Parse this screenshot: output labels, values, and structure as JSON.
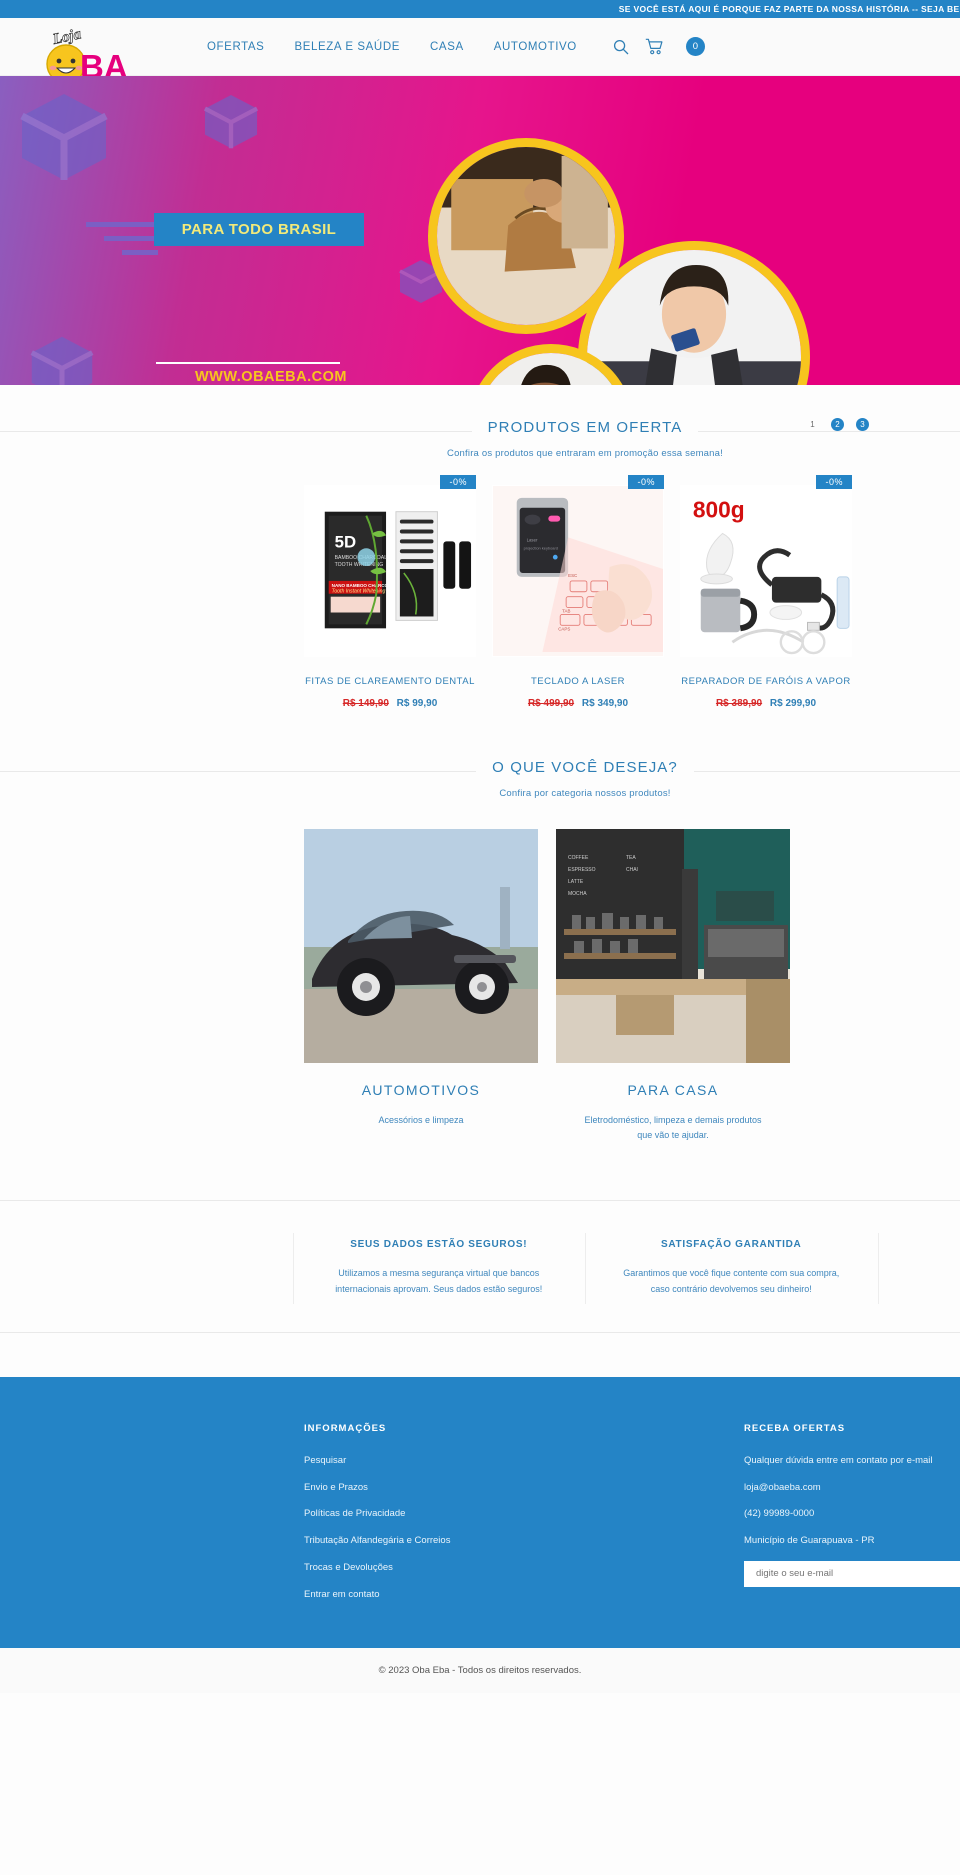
{
  "announce": {
    "text": "SE VOCÊ ESTÁ AQUI É PORQUE FAZ PARTE DA NOSSA HISTÓRIA -- SEJA BEM-VINDO!"
  },
  "header": {
    "logo_text_top": "Loja",
    "logo_text_main": "OBA",
    "nav": [
      {
        "label": "OFERTAS"
      },
      {
        "label": "BELEZA E SAÚDE"
      },
      {
        "label": "CASA"
      },
      {
        "label": "AUTOMOTIVO"
      }
    ],
    "search_icon": "search-icon",
    "cart_icon": "cart-icon",
    "cart_count": "0"
  },
  "hero": {
    "ribbon_text": "PARA TODO BRASIL",
    "url_text": "WWW.OBAEBA.COM",
    "slides": [
      {
        "label": "1"
      },
      {
        "label": "2"
      },
      {
        "label": "3"
      }
    ],
    "colors": {
      "magenta": "#e6007e",
      "purple": "#7b5fc4",
      "yellow": "#f7c51e",
      "blue": "#2484c6",
      "ribbon_text": "#f2ea7a"
    }
  },
  "offers": {
    "title": "PRODUTOS EM OFERTA",
    "subtitle": "Confira os produtos que entraram em promoção essa semana!",
    "products": [
      {
        "name": "FITAS DE CLAREAMENTO DENTAL",
        "badge": "-0%",
        "old_price": "R$ 149,90",
        "new_price": "R$ 99,90",
        "image": "teeth-whitening-strips-photo"
      },
      {
        "name": "TECLADO A LASER",
        "badge": "-0%",
        "old_price": "R$ 499,90",
        "new_price": "R$ 349,90",
        "image": "laser-keyboard-photo"
      },
      {
        "name": "REPARADOR DE FARÓIS A VAPOR",
        "badge": "-0%",
        "old_price": "R$ 389,90",
        "new_price": "R$ 299,90",
        "image": "headlight-steam-repair-kit-photo",
        "image_label": "800g"
      }
    ]
  },
  "categories": {
    "title": "O QUE VOCÊ DESEJA?",
    "subtitle": "Confira por categoria nossos produtos!",
    "items": [
      {
        "name": "AUTOMOTIVOS",
        "desc": "Acessórios e limpeza",
        "image": "classic-car-photo"
      },
      {
        "name": "PARA CASA",
        "desc": "Eletrodoméstico, limpeza e demais produtos que vão te ajudar.",
        "image": "modern-kitchen-photo"
      }
    ]
  },
  "trust": [
    {
      "title": "SEUS DADOS ESTÃO SEGUROS!",
      "desc": "Utilizamos a mesma segurança virtual que bancos internacionais aprovam. Seus dados estão seguros!"
    },
    {
      "title": "SATISFAÇÃO GARANTIDA",
      "desc": "Garantimos que você fique contente com sua compra, caso contrário devolvemos seu dinheiro!"
    }
  ],
  "footer": {
    "info_title": "INFORMAÇÕES",
    "info_links": [
      {
        "label": "Pesquisar"
      },
      {
        "label": "Envio e Prazos"
      },
      {
        "label": "Políticas de Privacidade"
      },
      {
        "label": "Tributação Alfandegária e Correios"
      },
      {
        "label": "Trocas e Devoluções"
      },
      {
        "label": "Entrar em contato"
      }
    ],
    "news_title": "RECEBA OFERTAS",
    "news_desc": "Qualquer dúvida entre em contato por e-mail",
    "email": "loja@obaeba.com",
    "phone": "(42) 99989-0000",
    "city": "Município de Guarapuava - PR",
    "news_placeholder": "digite o seu e-mail"
  },
  "copyright": "© 2023 Oba Eba - Todos os direitos reservados."
}
